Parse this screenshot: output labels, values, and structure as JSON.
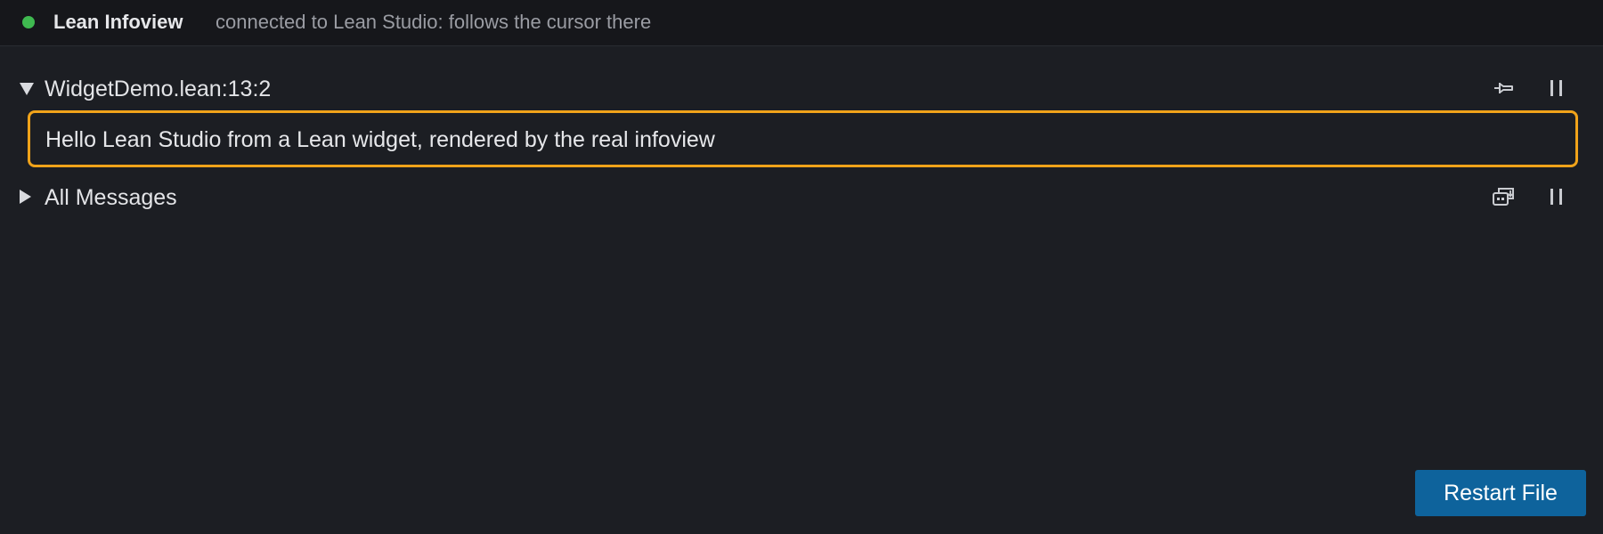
{
  "header": {
    "title": "Lean Infoview",
    "subtitle": "connected to Lean Studio: follows the cursor there",
    "status_color": "#3fb950"
  },
  "goal_section": {
    "label": "WidgetDemo.lean:13:2",
    "expanded": true,
    "icons": [
      "pin-icon",
      "pause-icon"
    ],
    "message": "Hello Lean Studio from a Lean widget, rendered by the real infoview",
    "highlight_color": "#f0a31a"
  },
  "messages_section": {
    "label": "All Messages",
    "expanded": false,
    "icons": [
      "go-to-file-icon",
      "pause-icon"
    ]
  },
  "footer": {
    "restart_label": "Restart File",
    "button_color": "#0e639c"
  }
}
